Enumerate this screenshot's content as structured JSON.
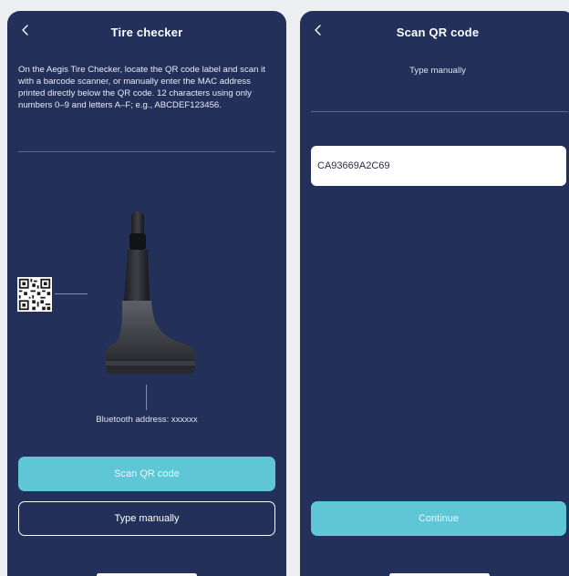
{
  "left_screen": {
    "title": "Tire checker",
    "instructions": "On the Aegis Tire Checker, locate the QR code label and scan it with a barcode scanner, or manually enter the MAC address printed directly below the QR code. 12 characters using only numbers 0–9 and letters A–F; e.g., ABCDEF123456.",
    "bluetooth_label": "Bluetooth address: xxxxxx",
    "scan_button": "Scan QR code",
    "manual_button": "Type manually",
    "back_icon": "chevron-left-icon"
  },
  "right_screen": {
    "title": "Scan QR code",
    "subtitle": "Type manually",
    "mac_value": "CA93669A2C69",
    "continue_button": "Continue",
    "back_icon": "chevron-left-icon"
  },
  "colors": {
    "screen_background": "#22305a",
    "accent": "#5fc6d6",
    "page_background": "#eceef2"
  }
}
